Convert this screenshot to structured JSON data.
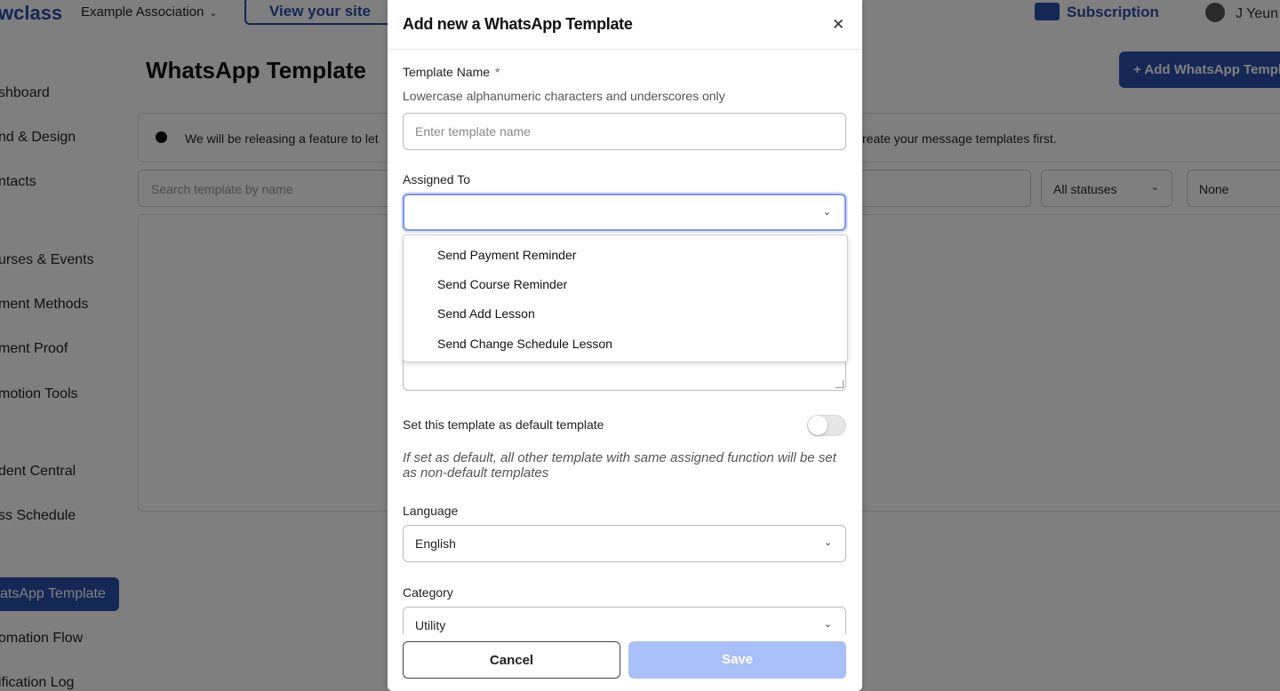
{
  "topbar": {
    "brand": "wclass",
    "org": "Example Association",
    "view_site": "View your site",
    "subscription": "Subscription",
    "user": "J Yeun"
  },
  "sidebar": {
    "items": [
      {
        "label": "shboard"
      },
      {
        "label": "nd & Design"
      },
      {
        "label": "ntacts"
      },
      {
        "label": "urses & Events"
      },
      {
        "label": "ment Methods"
      },
      {
        "label": "ment Proof"
      },
      {
        "label": "motion Tools"
      },
      {
        "label": "dent Central"
      },
      {
        "label": "ss Schedule"
      },
      {
        "label": "atsApp Template"
      },
      {
        "label": "omation Flow"
      },
      {
        "label": "ification Log"
      }
    ]
  },
  "page": {
    "title": "WhatsApp Template",
    "add_button": "+ Add WhatsApp Templa",
    "info_left": "We will be releasing a feature to let",
    "info_right": "reate your message templates first.",
    "search_placeholder": "Search template by name",
    "status_filter": "All statuses",
    "second_filter": "None"
  },
  "modal": {
    "title": "Add new a WhatsApp Template",
    "template_name": {
      "label": "Template Name",
      "required_mark": "*",
      "help": "Lowercase alphanumeric characters and underscores only",
      "placeholder": "Enter template name",
      "value": ""
    },
    "assigned_to": {
      "label": "Assigned To",
      "value": "",
      "options": [
        "Send Payment Reminder",
        "Send Course Reminder",
        "Send Add Lesson",
        "Send Change Schedule Lesson"
      ]
    },
    "default_toggle": {
      "label": "Set this template as default template",
      "on": false,
      "note": "If set as default, all other template with same assigned function will be set as non-default templates"
    },
    "language": {
      "label": "Language",
      "value": "English"
    },
    "category": {
      "label": "Category",
      "value": "Utility"
    },
    "cancel_label": "Cancel",
    "save_label": "Save"
  },
  "colors": {
    "accent": "#2b4ea8",
    "save_disabled": "#a9bff7",
    "focus_ring": "#7a96e8"
  }
}
